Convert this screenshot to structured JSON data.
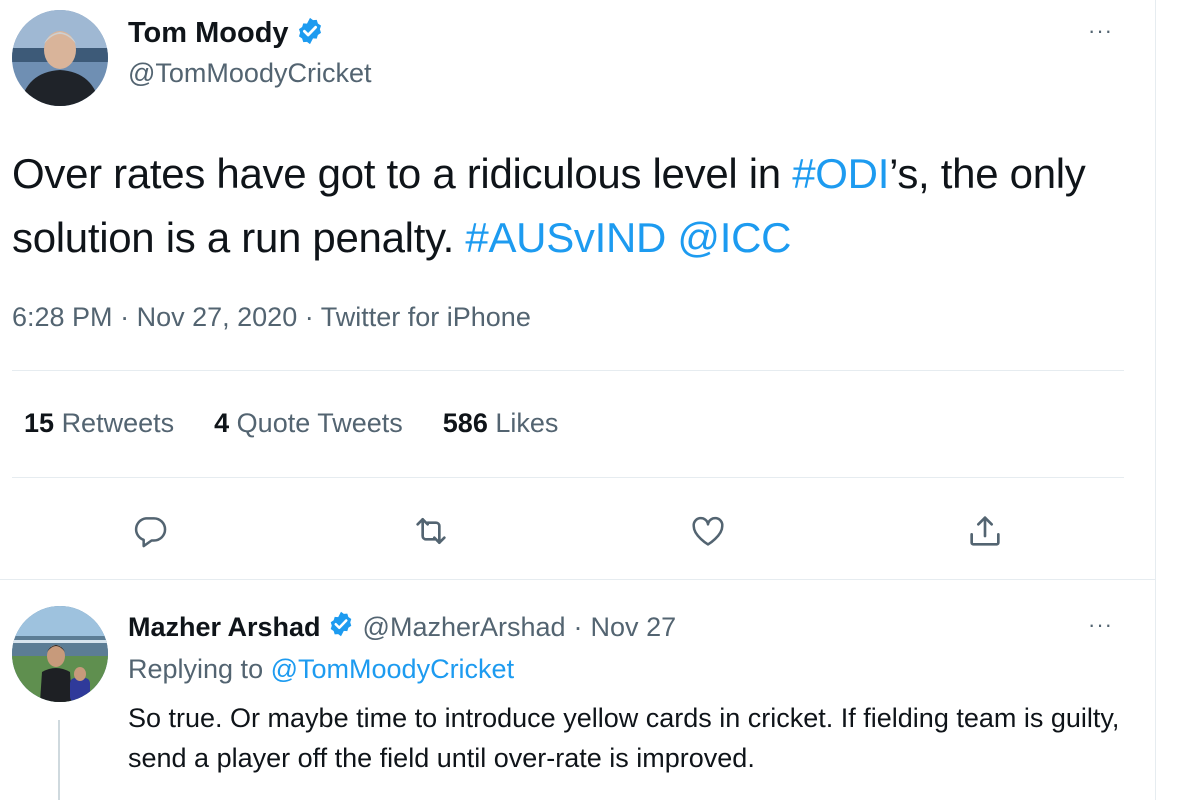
{
  "main_tweet": {
    "name": "Tom Moody",
    "handle": "@TomMoodyCricket",
    "text_1": "Over rates have got to a ridiculous level in ",
    "hashtag_odi": "#ODI",
    "text_2": "’s, the only solution is a run penalty. ",
    "hashtag_ausvind": "#AUSvIND",
    "mention_icc": "@ICC",
    "time": "6:28 PM",
    "date": "Nov 27, 2020",
    "source": "Twitter for iPhone",
    "separator": "·",
    "stats": {
      "retweets_count": "15",
      "retweets_label": "Retweets",
      "quotes_count": "4",
      "quotes_label": "Quote Tweets",
      "likes_count": "586",
      "likes_label": "Likes"
    },
    "more_label": "···"
  },
  "reply_tweet": {
    "name": "Mazher Arshad",
    "handle": "@MazherArshad",
    "separator": "·",
    "date": "Nov 27",
    "replying_prefix": "Replying to",
    "replying_to": "@TomMoodyCricket",
    "text": "So true. Or maybe time to introduce yellow cards in cricket. If fielding team is guilty, send a player off the field until over-rate is improved.",
    "more_label": "···"
  },
  "icons": [
    "verified-badge-icon",
    "reply-icon",
    "retweet-icon",
    "like-icon",
    "share-icon",
    "more-icon"
  ],
  "colors": {
    "link": "#1d9bf0",
    "secondary_text": "#536471",
    "primary_text": "#0f1419",
    "divider": "#e6ecf0"
  }
}
